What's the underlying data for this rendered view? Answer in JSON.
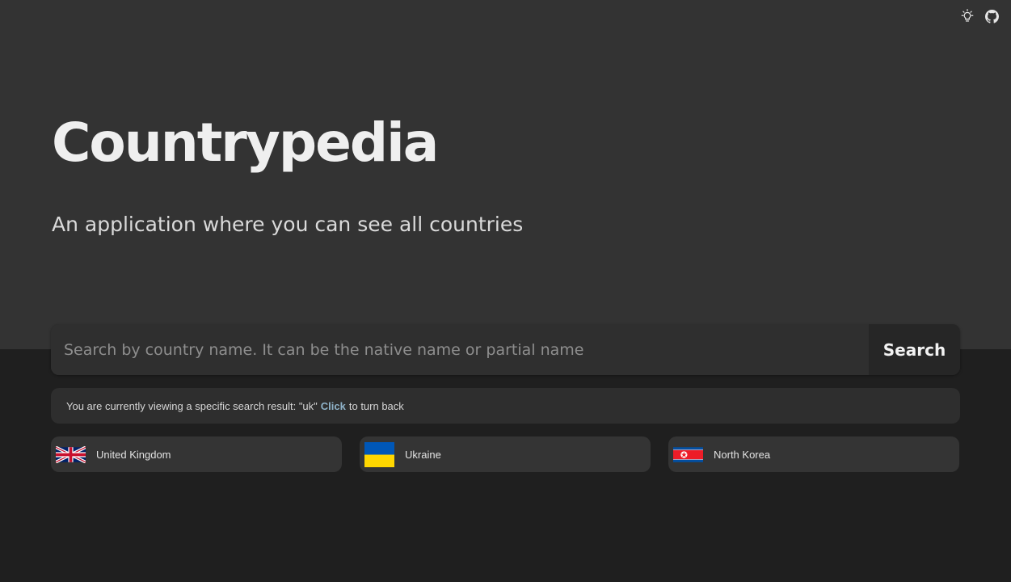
{
  "header": {
    "icons": [
      "lightbulb-icon",
      "github-icon"
    ]
  },
  "hero": {
    "title": "Countrypedia",
    "subtitle": "An application where you can see all countries"
  },
  "search": {
    "placeholder": "Search by country name. It can be the native name or partial name",
    "value": "",
    "button_label": "Search"
  },
  "notice": {
    "prefix": "You are currently viewing a specific search result: \"uk\"",
    "link_label": "Click",
    "suffix": "to turn back"
  },
  "results": [
    {
      "name": "United Kingdom",
      "flag_icon": "uk-flag-icon"
    },
    {
      "name": "Ukraine",
      "flag_icon": "ukraine-flag-icon"
    },
    {
      "name": "North Korea",
      "flag_icon": "north-korea-flag-icon"
    }
  ],
  "colors": {
    "hero_bg": "#333333",
    "page_bg": "#1f1f1f",
    "link": "#8fb3c9"
  }
}
